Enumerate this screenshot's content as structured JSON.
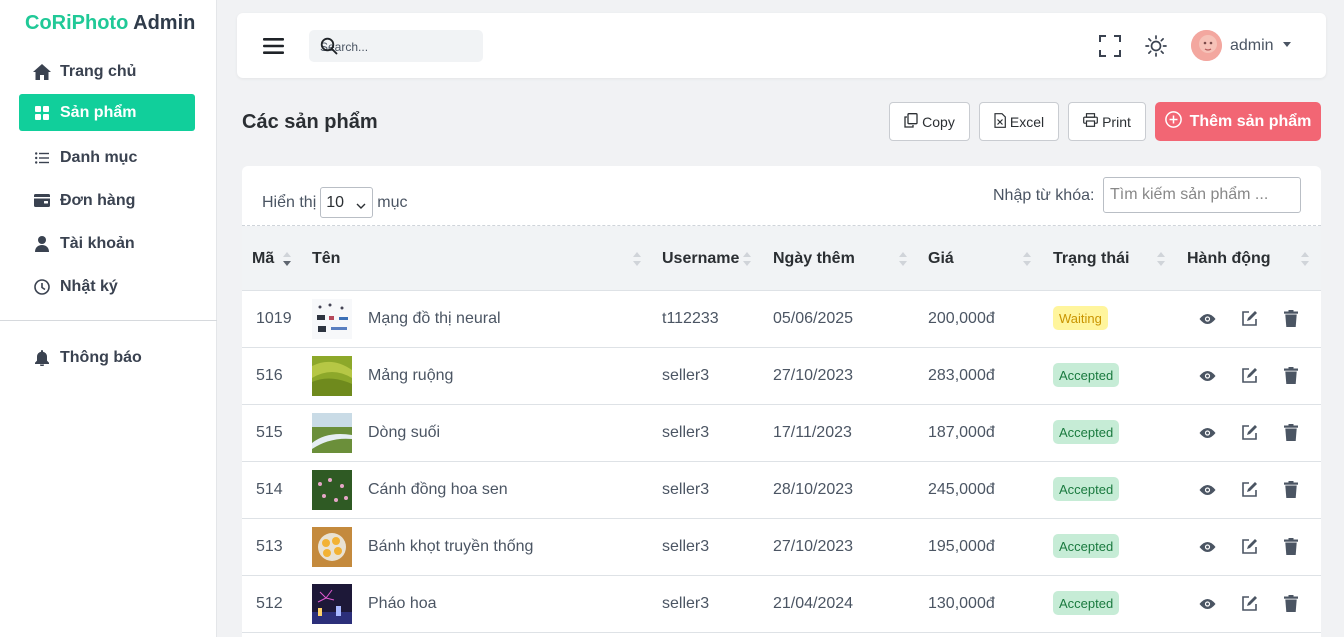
{
  "brand": {
    "name_primary": "CoRiPhoto",
    "name_secondary": "Admin",
    "accent_color": "#20c997"
  },
  "sidebar": {
    "items": [
      {
        "label": "Trang chủ",
        "icon": "home-icon",
        "active": false
      },
      {
        "label": "Sản phẩm",
        "icon": "grid-icon",
        "active": true
      },
      {
        "label": "Danh mục",
        "icon": "list-icon",
        "active": false
      },
      {
        "label": "Đơn hàng",
        "icon": "wallet-icon",
        "active": false
      },
      {
        "label": "Tài khoản",
        "icon": "user-icon",
        "active": false
      },
      {
        "label": "Nhật ký",
        "icon": "clock-icon",
        "active": false
      }
    ],
    "bottom_items": [
      {
        "label": "Thông báo",
        "icon": "bell-icon"
      }
    ]
  },
  "topbar": {
    "search_placeholder": "Search...",
    "username": "admin"
  },
  "page": {
    "title": "Các sản phẩm"
  },
  "toolbar": {
    "copy_label": "Copy",
    "excel_label": "Excel",
    "print_label": "Print",
    "add_label": "Thêm sản phẩm",
    "add_color": "#f26674"
  },
  "table_controls": {
    "show_label": "Hiển thị",
    "page_size": "10",
    "entries_label": "mục",
    "keyword_label": "Nhập từ khóa:",
    "keyword_placeholder": "Tìm kiếm sản phẩm ..."
  },
  "table": {
    "columns": [
      "Mã",
      "Tên",
      "Username",
      "Ngày thêm",
      "Giá",
      "Trạng thái",
      "Hành động"
    ],
    "rows": [
      {
        "id": "1019",
        "name": "Mạng đồ thị neural",
        "username": "t112233",
        "date": "05/06/2025",
        "price": "200,000đ",
        "status": "Waiting"
      },
      {
        "id": "516",
        "name": "Mảng ruộng",
        "username": "seller3",
        "date": "27/10/2023",
        "price": "283,000đ",
        "status": "Accepted"
      },
      {
        "id": "515",
        "name": "Dòng suối",
        "username": "seller3",
        "date": "17/11/2023",
        "price": "187,000đ",
        "status": "Accepted"
      },
      {
        "id": "514",
        "name": "Cánh đồng hoa sen",
        "username": "seller3",
        "date": "28/10/2023",
        "price": "245,000đ",
        "status": "Accepted"
      },
      {
        "id": "513",
        "name": "Bánh khọt truyền thống",
        "username": "seller3",
        "date": "27/10/2023",
        "price": "195,000đ",
        "status": "Accepted"
      },
      {
        "id": "512",
        "name": "Pháo hoa",
        "username": "seller3",
        "date": "21/04/2024",
        "price": "130,000đ",
        "status": "Accepted"
      }
    ]
  }
}
